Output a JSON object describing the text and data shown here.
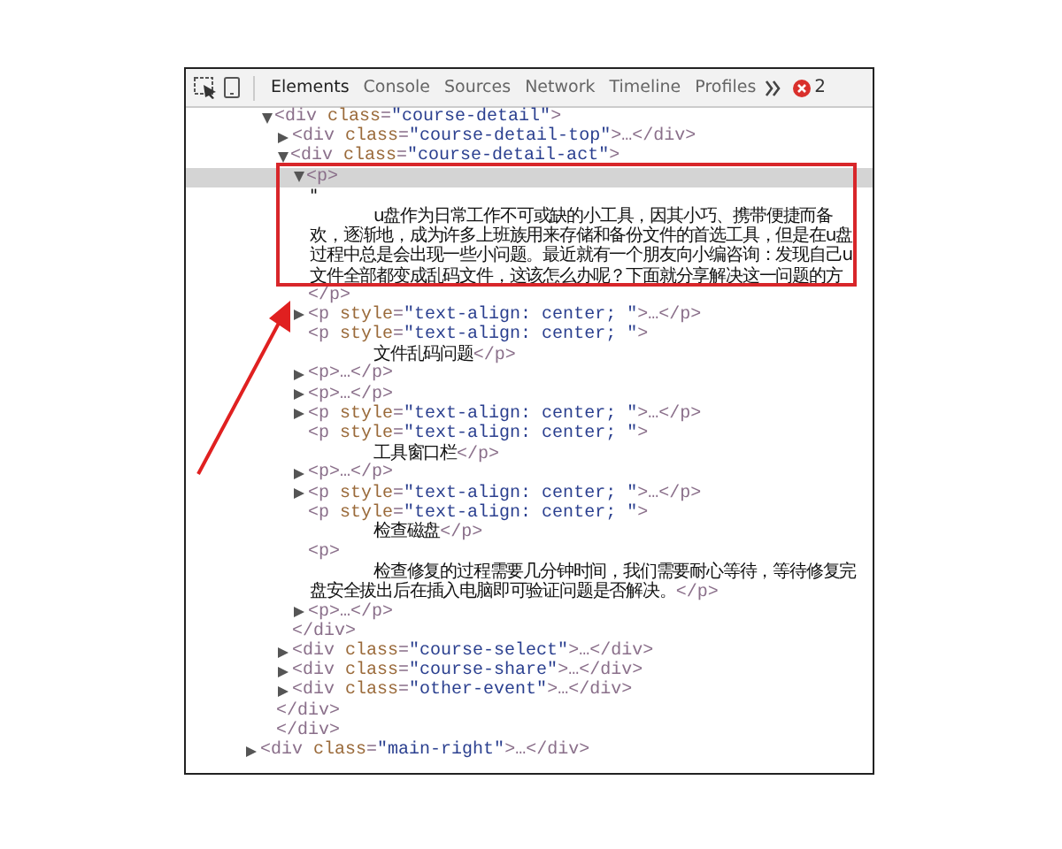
{
  "toolbar": {
    "tabs": [
      {
        "label": "Elements",
        "selected": true
      },
      {
        "label": "Console",
        "selected": false
      },
      {
        "label": "Sources",
        "selected": false
      },
      {
        "label": "Network",
        "selected": false
      },
      {
        "label": "Timeline",
        "selected": false
      },
      {
        "label": "Profiles",
        "selected": false
      }
    ],
    "error_count": "2"
  },
  "dom_tree": [
    {
      "kind": "fragment",
      "closing": "</div>",
      "children": [
        {
          "kind": "expanded",
          "markup": "<div class=\"course-detail\">",
          "selected": false,
          "closing": "</div>",
          "children": [
            {
              "kind": "collapsed",
              "markup": "<div class=\"course-detail-top\">…</div>",
              "selected": false
            },
            {
              "kind": "expanded",
              "markup": "<div class=\"course-detail-act\">",
              "selected": false,
              "closing": "</div>",
              "children": [
                {
                  "kind": "expanded",
                  "markup": "<p>",
                  "selected": true,
                  "closing": "</p>",
                  "children": [
                    {
                      "kind": "text",
                      "lead": "\"",
                      "lines": [
                        "u盘作为日常工作不可或缺的小工具，因其小巧、携带便捷而备",
                        "欢，逐渐地，成为许多上班族用来存储和备份文件的首选工具，但是在u盘",
                        "过程中总是会出现一些小问题。最近就有一个朋友向小编咨询：发现自己u",
                        "文件全部都变成乱码文件，这该怎么办呢？下面就分享解决这一问题的方"
                      ]
                    }
                  ]
                },
                {
                  "kind": "collapsed",
                  "markup": "<p style=\"text-align: center; \">…</p>",
                  "selected": false
                },
                {
                  "kind": "inline",
                  "markup": "<p style=\"text-align: center; \">",
                  "selected": false,
                  "lines": [
                    "文件乱码问题"
                  ],
                  "closing": "</p>"
                },
                {
                  "kind": "collapsed",
                  "markup": "<p>…</p>",
                  "selected": false
                },
                {
                  "kind": "collapsed",
                  "markup": "<p>…</p>",
                  "selected": false
                },
                {
                  "kind": "collapsed",
                  "markup": "<p style=\"text-align: center; \">…</p>",
                  "selected": false
                },
                {
                  "kind": "inline",
                  "markup": "<p style=\"text-align: center; \">",
                  "selected": false,
                  "lines": [
                    "工具窗口栏"
                  ],
                  "closing": "</p>"
                },
                {
                  "kind": "collapsed",
                  "markup": "<p>…</p>",
                  "selected": false
                },
                {
                  "kind": "collapsed",
                  "markup": "<p style=\"text-align: center; \">…</p>",
                  "selected": false
                },
                {
                  "kind": "inline",
                  "markup": "<p style=\"text-align: center; \">",
                  "selected": false,
                  "lines": [
                    "检查磁盘"
                  ],
                  "closing": "</p>"
                },
                {
                  "kind": "inline",
                  "markup": "<p>",
                  "selected": false,
                  "lines": [
                    "检查修复的过程需要几分钟时间，我们需要耐心等待，等待修复完",
                    "盘安全拔出后在插入电脑即可验证问题是否解决。"
                  ],
                  "closing": "</p>"
                },
                {
                  "kind": "collapsed",
                  "markup": "<p>…</p>",
                  "selected": false
                }
              ]
            },
            {
              "kind": "collapsed",
              "markup": "<div class=\"course-select\">…</div>",
              "selected": false
            },
            {
              "kind": "collapsed",
              "markup": "<div class=\"course-share\">…</div>",
              "selected": false
            },
            {
              "kind": "collapsed",
              "markup": "<div class=\"other-event\">…</div>",
              "selected": false
            }
          ]
        }
      ]
    },
    {
      "kind": "collapsed",
      "markup": "<div class=\"main-right\">…</div>",
      "selected": false
    }
  ]
}
